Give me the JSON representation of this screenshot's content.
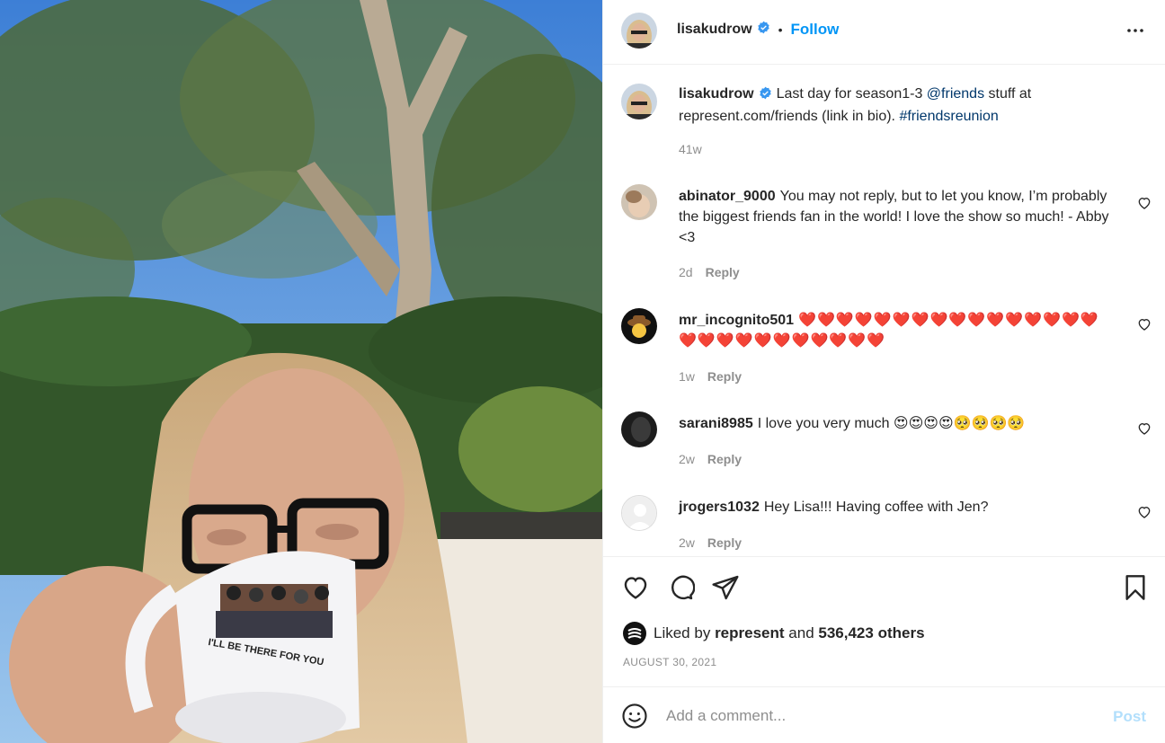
{
  "post": {
    "author": "lisakudrow",
    "follow_label": "Follow",
    "separator": "•",
    "caption": {
      "text_1": "Last day for season1-3",
      "mention": "@friends",
      "text_2": "stuff at represent.com/friends (link in bio).",
      "hashtag": "#friendsreunion",
      "time": "41w"
    },
    "mug_text": "I'LL BE THERE FOR YOU"
  },
  "comments": [
    {
      "user": "abinator_9000",
      "text": "You may not reply, but to let you know, I’m probably the biggest friends fan in the world! I love the show so much! - Abby <3",
      "time": "2d",
      "reply": "Reply"
    },
    {
      "user": "mr_incognito501",
      "text": "❤️❤️❤️❤️❤️❤️❤️❤️❤️❤️❤️❤️❤️❤️❤️❤️❤️❤️❤️❤️❤️❤️❤️❤️❤️❤️❤️",
      "time": "1w",
      "reply": "Reply"
    },
    {
      "user": "sarani8985",
      "text": "I love you very much 😍😍😍😍🥺🥺🥺🥺",
      "time": "2w",
      "reply": "Reply"
    },
    {
      "user": "jrogers1032",
      "text": "Hey Lisa!!! Having coffee with Jen?",
      "time": "2w",
      "reply": "Reply"
    }
  ],
  "likes": {
    "prefix": "Liked by",
    "user": "represent",
    "conj": "and",
    "count": "536,423 others"
  },
  "date": "AUGUST 30, 2021",
  "comment_input": {
    "placeholder": "Add a comment..."
  },
  "post_button": "Post",
  "icons": {
    "more": "more-options-icon",
    "like": "heart-icon",
    "comment": "comment-bubble-icon",
    "share": "paper-plane-icon",
    "save": "bookmark-icon",
    "emoji": "smiley-icon",
    "verified": "verified-badge-icon"
  },
  "colors": {
    "accent": "#0095f6",
    "link": "#00376b",
    "muted": "#8e8e8e",
    "heart": "#e0112b"
  }
}
